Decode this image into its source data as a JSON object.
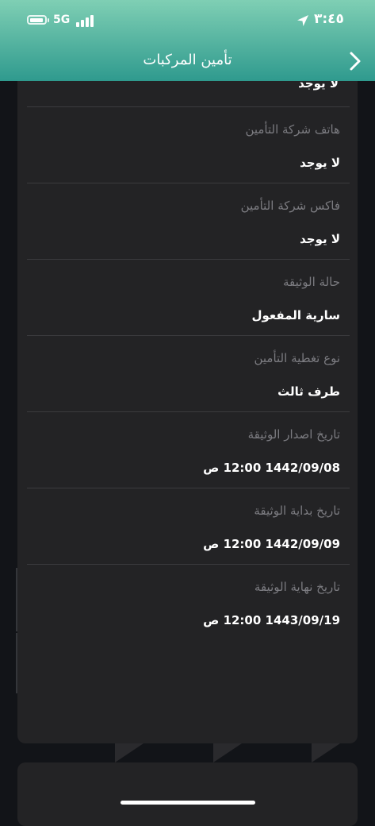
{
  "status_bar": {
    "network": "5G",
    "time": "٣:٤٥",
    "battery_level": 0.75
  },
  "header": {
    "title": "تأمين المركبات",
    "back_icon": "chevron-right-icon"
  },
  "details": {
    "partial_value": "لا يوجد",
    "rows": [
      {
        "label": "هاتف شركة التأمين",
        "value": "لا يوجد"
      },
      {
        "label": "فاكس شركة التأمين",
        "value": "لا يوجد"
      },
      {
        "label": "حالة الوثيقة",
        "value": "سارية المفعول"
      },
      {
        "label": "نوع تغطية التأمين",
        "value": "طرف ثالث"
      },
      {
        "label": "تاريخ اصدار الوثيقة",
        "value": "1442/09/08 12:00 ص"
      },
      {
        "label": "تاريخ بداية الوثيقة",
        "value": "1442/09/09 12:00 ص"
      },
      {
        "label": "تاريخ نهاية الوثيقة",
        "value": "1443/09/19 12:00 ص"
      }
    ]
  },
  "colors": {
    "header_top": "#7fcfb4",
    "header_bottom": "#2f9a8e",
    "card_bg": "#232325",
    "page_bg": "#121418",
    "label": "#7b7b80",
    "value": "#ffffff"
  }
}
